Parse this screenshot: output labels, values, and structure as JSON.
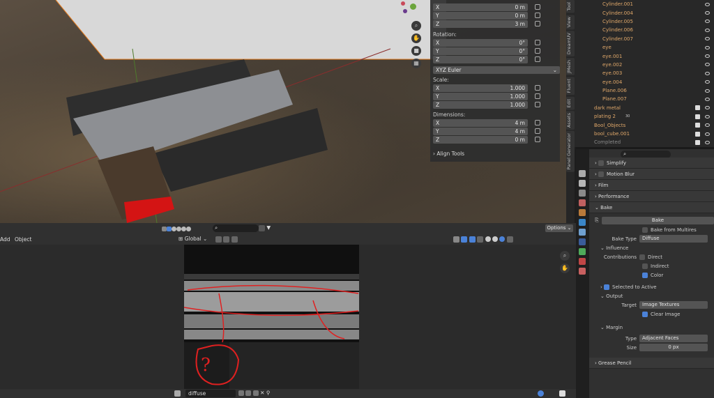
{
  "npanel": {
    "location_rows": [
      {
        "axis": "X",
        "value": "0 m"
      },
      {
        "axis": "Y",
        "value": "0 m"
      },
      {
        "axis": "Z",
        "value": "3 m"
      }
    ],
    "rotation_label": "Rotation:",
    "rotation_rows": [
      {
        "axis": "X",
        "value": "0°"
      },
      {
        "axis": "Y",
        "value": "0°"
      },
      {
        "axis": "Z",
        "value": "0°"
      }
    ],
    "rotation_mode": "XYZ Euler",
    "scale_label": "Scale:",
    "scale_rows": [
      {
        "axis": "X",
        "value": "1.000"
      },
      {
        "axis": "Y",
        "value": "1.000"
      },
      {
        "axis": "Z",
        "value": "1.000"
      }
    ],
    "dimensions_label": "Dimensions:",
    "dimension_rows": [
      {
        "axis": "X",
        "value": "4 m"
      },
      {
        "axis": "Y",
        "value": "4 m"
      },
      {
        "axis": "Z",
        "value": "0 m"
      }
    ],
    "align_tools": "Align Tools"
  },
  "vtabs": [
    "Tool",
    "View",
    "DreamUV",
    "JMesh",
    "Fluent",
    "Edit",
    "Assets",
    "Panel Generator"
  ],
  "outliner": [
    "Cylinder.001",
    "Cylinder.004",
    "Cylinder.005",
    "Cylinder.006",
    "Cylinder.007",
    "eye",
    "eye.001",
    "eye.002",
    "eye.003",
    "eye.004",
    "Plane.006",
    "Plane.007",
    "dark metal",
    "plating 2",
    "Bool_Objects",
    "bool_cube.001",
    "Completed"
  ],
  "outliner_badge": "30",
  "props": {
    "simplify": "Simplify",
    "motion_blur": "Motion Blur",
    "film": "Film",
    "performance": "Performance",
    "bake": "Bake",
    "bake_button": "Bake",
    "bake_multires": "Bake from Multires",
    "bake_type_label": "Bake Type",
    "bake_type": "Diffuse",
    "influence": "Influence",
    "contributions": "Contributions",
    "direct": "Direct",
    "indirect": "Indirect",
    "color": "Color",
    "selected_to_active": "Selected to Active",
    "output": "Output",
    "target_label": "Target",
    "target": "Image Textures",
    "clear_image": "Clear Image",
    "margin": "Margin",
    "type_label": "Type",
    "type": "Adjacent Faces",
    "size_label": "Size",
    "size": "0 px",
    "grease_pencil": "Grease Pencil"
  },
  "header3d": {
    "options": "Options"
  },
  "imgEditor": {
    "add": "Add",
    "object": "Object",
    "orientation": "Global",
    "image_name": "diffuse",
    "annotation": "?"
  }
}
